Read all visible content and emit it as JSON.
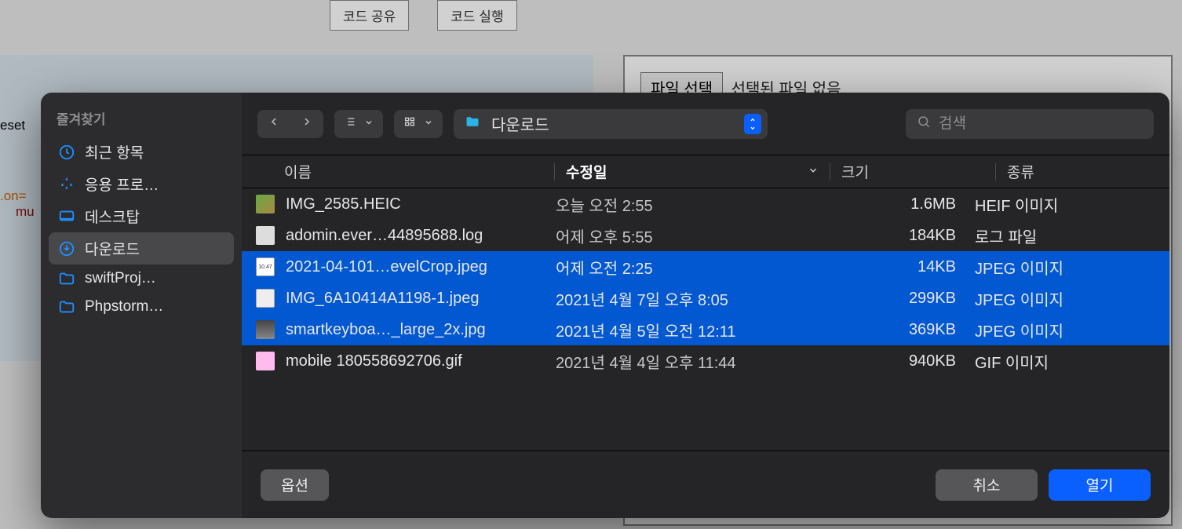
{
  "background": {
    "btn_share": "코드 공유",
    "btn_run": "코드 실행",
    "code_snip1": "eset",
    "code_snip2": ".on=",
    "code_snip3": "mu",
    "file_select_btn": "파일 선택",
    "file_select_text": "선택된 파일 없음"
  },
  "finder": {
    "sidebar": {
      "header": "즐겨찾기",
      "items": [
        {
          "label": "최근 항목"
        },
        {
          "label": "응용 프로…"
        },
        {
          "label": "데스크탑"
        },
        {
          "label": "다운로드"
        },
        {
          "label": "swiftProj…"
        },
        {
          "label": "Phpstorm…"
        }
      ]
    },
    "toolbar": {
      "location": "다운로드",
      "search_placeholder": "검색"
    },
    "columns": {
      "name": "이름",
      "date": "수정일",
      "size": "크기",
      "kind": "종류"
    },
    "files": [
      {
        "name": "IMG_2585.HEIC",
        "date": "오늘 오전 2:55",
        "size": "1.6MB",
        "kind": "HEIF 이미지",
        "icon": "fi-heic",
        "sel": false
      },
      {
        "name": "adomin.ever…44895688.log",
        "date": "어제 오후 5:55",
        "size": "184KB",
        "kind": "로그 파일",
        "icon": "fi-log",
        "sel": false
      },
      {
        "name": "2021-04-101…evelCrop.jpeg",
        "date": "어제 오전 2:25",
        "size": "14KB",
        "kind": "JPEG 이미지",
        "icon": "fi-jpeg1",
        "sel": true
      },
      {
        "name": "IMG_6A10414A1198-1.jpeg",
        "date": "2021년 4월 7일 오후 8:05",
        "size": "299KB",
        "kind": "JPEG 이미지",
        "icon": "fi-jpeg2",
        "sel": true
      },
      {
        "name": "smartkeyboa…_large_2x.jpg",
        "date": "2021년 4월 5일 오전 12:11",
        "size": "369KB",
        "kind": "JPEG 이미지",
        "icon": "fi-jpeg3",
        "sel": true
      },
      {
        "name": "mobile 180558692706.gif",
        "date": "2021년 4월 4일 오후 11:44",
        "size": "940KB",
        "kind": "GIF 이미지",
        "icon": "fi-gif",
        "sel": false
      }
    ],
    "footer": {
      "options": "옵션",
      "cancel": "취소",
      "open": "열기"
    }
  }
}
